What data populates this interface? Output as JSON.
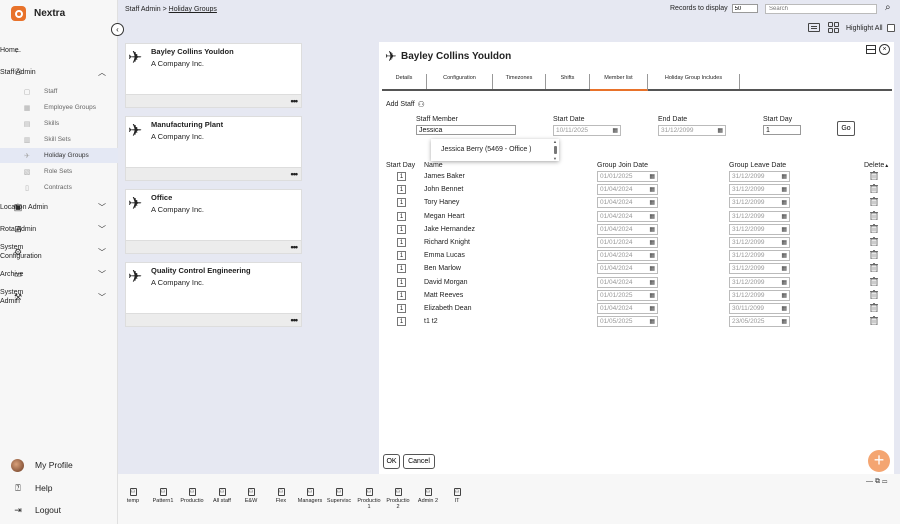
{
  "app": {
    "name": "Nextra"
  },
  "sidebar": {
    "items": [
      {
        "label": "Home",
        "icon": "arrow-left-icon"
      },
      {
        "label": "Staff Admin",
        "icon": "users-icon",
        "expanded": true
      },
      {
        "label": "Location Admin",
        "icon": "building-icon"
      },
      {
        "label": "Rota Admin",
        "icon": "grid-icon"
      },
      {
        "label": "System Configuration",
        "icon": "gear-icon"
      },
      {
        "label": "Archive",
        "icon": "archive-icon"
      },
      {
        "label": "System Admin",
        "icon": "wrench-icon"
      }
    ],
    "sub_items": [
      {
        "label": "Staff"
      },
      {
        "label": "Employee Groups"
      },
      {
        "label": "Skills"
      },
      {
        "label": "Skill Sets"
      },
      {
        "label": "Holiday Groups",
        "active": true
      },
      {
        "label": "Role Sets"
      },
      {
        "label": "Contracts"
      }
    ],
    "bottom": [
      {
        "label": "My Profile"
      },
      {
        "label": "Help"
      },
      {
        "label": "Logout"
      }
    ]
  },
  "topbar": {
    "breadcrumb_root": "Staff Admin",
    "breadcrumb_sep": ">",
    "breadcrumb_current": "Holiday Groups",
    "records_label": "Records to display",
    "records_value": "50",
    "search_placeholder": "Search",
    "highlight_label": "Highlight All"
  },
  "groups": [
    {
      "title": "Bayley Collins Youldon",
      "company": "A Company Inc."
    },
    {
      "title": "Manufacturing Plant",
      "company": "A Company Inc."
    },
    {
      "title": "Office",
      "company": "A Company Inc."
    },
    {
      "title": "Quality Control Engineering",
      "company": "A Company Inc."
    }
  ],
  "detail": {
    "title": "Bayley Collins Youldon",
    "tabs": [
      {
        "label": "Details"
      },
      {
        "label": "Configuration"
      },
      {
        "label": "Timezones"
      },
      {
        "label": "Shifts"
      },
      {
        "label": "Member list",
        "active": true
      },
      {
        "label": "Holiday Group Includes"
      }
    ],
    "add_staff_label": "Add Staff",
    "form": {
      "staff_member_label": "Staff Member",
      "staff_member_value": "Jessica",
      "start_date_label": "Start Date",
      "start_date_value": "10/11/2025",
      "end_date_label": "End Date",
      "end_date_value": "31/12/2099",
      "start_day_label": "Start Day",
      "start_day_value": "1",
      "go_label": "Go"
    },
    "dropdown_option": "Jessica Berry (5469 - Office )",
    "columns": {
      "start_day": "Start Day",
      "name": "Name",
      "join": "Group Join Date",
      "leave": "Group Leave Date",
      "delete": "Delete"
    },
    "rows": [
      {
        "day": "1",
        "name": "James Baker",
        "join": "01/01/2025",
        "leave": "31/12/2099"
      },
      {
        "day": "1",
        "name": "John Bennet",
        "join": "01/04/2024",
        "leave": "31/12/2099"
      },
      {
        "day": "1",
        "name": "Tory Haney",
        "join": "01/04/2024",
        "leave": "31/12/2099"
      },
      {
        "day": "1",
        "name": "Megan Heart",
        "join": "01/04/2024",
        "leave": "31/12/2099"
      },
      {
        "day": "1",
        "name": "Jake Hernandez",
        "join": "01/04/2024",
        "leave": "31/12/2099"
      },
      {
        "day": "1",
        "name": "Richard Knight",
        "join": "01/01/2024",
        "leave": "31/12/2099"
      },
      {
        "day": "1",
        "name": "Emma Lucas",
        "join": "01/04/2024",
        "leave": "31/12/2099"
      },
      {
        "day": "1",
        "name": "Ben Marlow",
        "join": "01/04/2024",
        "leave": "31/12/2099"
      },
      {
        "day": "1",
        "name": "David Morgan",
        "join": "01/04/2024",
        "leave": "31/12/2099"
      },
      {
        "day": "1",
        "name": "Matt Reeves",
        "join": "01/01/2025",
        "leave": "31/12/2099"
      },
      {
        "day": "1",
        "name": "Elizabeth Dean",
        "join": "01/04/2024",
        "leave": "30/11/2099"
      },
      {
        "day": "1",
        "name": "t1 t2",
        "join": "01/05/2025",
        "leave": "23/05/2025"
      }
    ],
    "ok_label": "OK",
    "cancel_label": "Cancel"
  },
  "bottom_bar": [
    {
      "label": "temp",
      "label2": ""
    },
    {
      "label": "Pattern1",
      "label2": ""
    },
    {
      "label": "Productio",
      "label2": ""
    },
    {
      "label": "All staff",
      "label2": ""
    },
    {
      "label": "E&W",
      "label2": ""
    },
    {
      "label": "Flex",
      "label2": ""
    },
    {
      "label": "Managers",
      "label2": ""
    },
    {
      "label": "Supervisc",
      "label2": ""
    },
    {
      "label": "Productio",
      "label2": "1"
    },
    {
      "label": "Productio",
      "label2": "2"
    },
    {
      "label": "Admin 2",
      "label2": ""
    },
    {
      "label": "IT",
      "label2": ""
    }
  ],
  "colors": {
    "accent": "#e8722a",
    "fab": "#f4a571",
    "background": "#e6e8f2"
  }
}
